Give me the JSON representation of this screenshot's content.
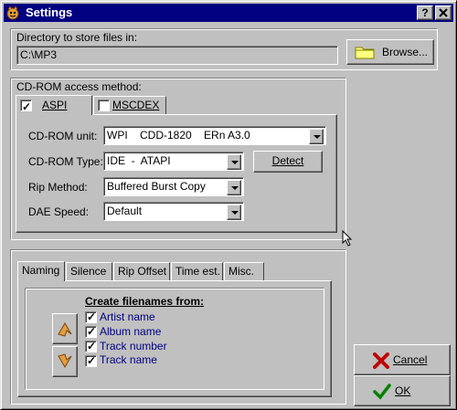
{
  "window": {
    "title": "Settings",
    "help_label": "?",
    "close_label": "X"
  },
  "directory": {
    "label": "Directory to store files in:",
    "value": "C:\\MP3",
    "browse_label": "Browse..."
  },
  "cdrom": {
    "group_label": "CD-ROM access method:",
    "tabs": [
      {
        "label": "ASPI",
        "checked": true,
        "active": true
      },
      {
        "label": "MSCDEX",
        "checked": false,
        "active": false
      }
    ],
    "unit_label": "CD-ROM unit:",
    "unit_value": "WPI    CDD-1820    ERn A3.0",
    "type_label": "CD-ROM Type:",
    "type_value": "IDE  -  ATAPI",
    "detect_label": "Detect",
    "rip_label": "Rip Method:",
    "rip_value": "Buffered Burst Copy",
    "dae_label": "DAE Speed:",
    "dae_value": "Default"
  },
  "naming": {
    "tabs": [
      "Naming",
      "Silence",
      "Rip Offset",
      "Time est.",
      "Misc."
    ],
    "header": "Create filenames from:",
    "items": [
      "Artist name",
      "Album name",
      "Track number",
      "Track name"
    ]
  },
  "buttons": {
    "cancel_label": "Cancel",
    "ok_label": "OK"
  },
  "colors": {
    "titlebar": "#000080",
    "face": "#c0c0c0",
    "item_text": "#000080"
  }
}
